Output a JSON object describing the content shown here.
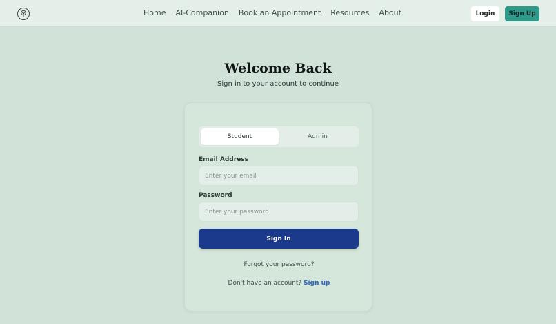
{
  "nav": {
    "logo_icon": "tree-icon",
    "links": [
      "Home",
      "AI-Companion",
      "Book an Appointment",
      "Resources",
      "About"
    ],
    "login_label": "Login",
    "signup_label": "Sign Up"
  },
  "header": {
    "title": "Welcome Back",
    "subtitle": "Sign in to your account to continue"
  },
  "form": {
    "tabs": [
      "Student",
      "Admin"
    ],
    "email_label": "Email Address",
    "email_placeholder": "Enter your email",
    "password_label": "Password",
    "password_placeholder": "Enter your password",
    "signin_label": "Sign In",
    "forgot_label": "Forgot your password?",
    "no_account_text": "Don't have an account?",
    "signup_link": "Sign up"
  },
  "colors": {
    "background": "#d1e2d8",
    "accent": "#2f9a8a",
    "primary_button": "#1c3a8c",
    "link": "#2a64c4"
  }
}
